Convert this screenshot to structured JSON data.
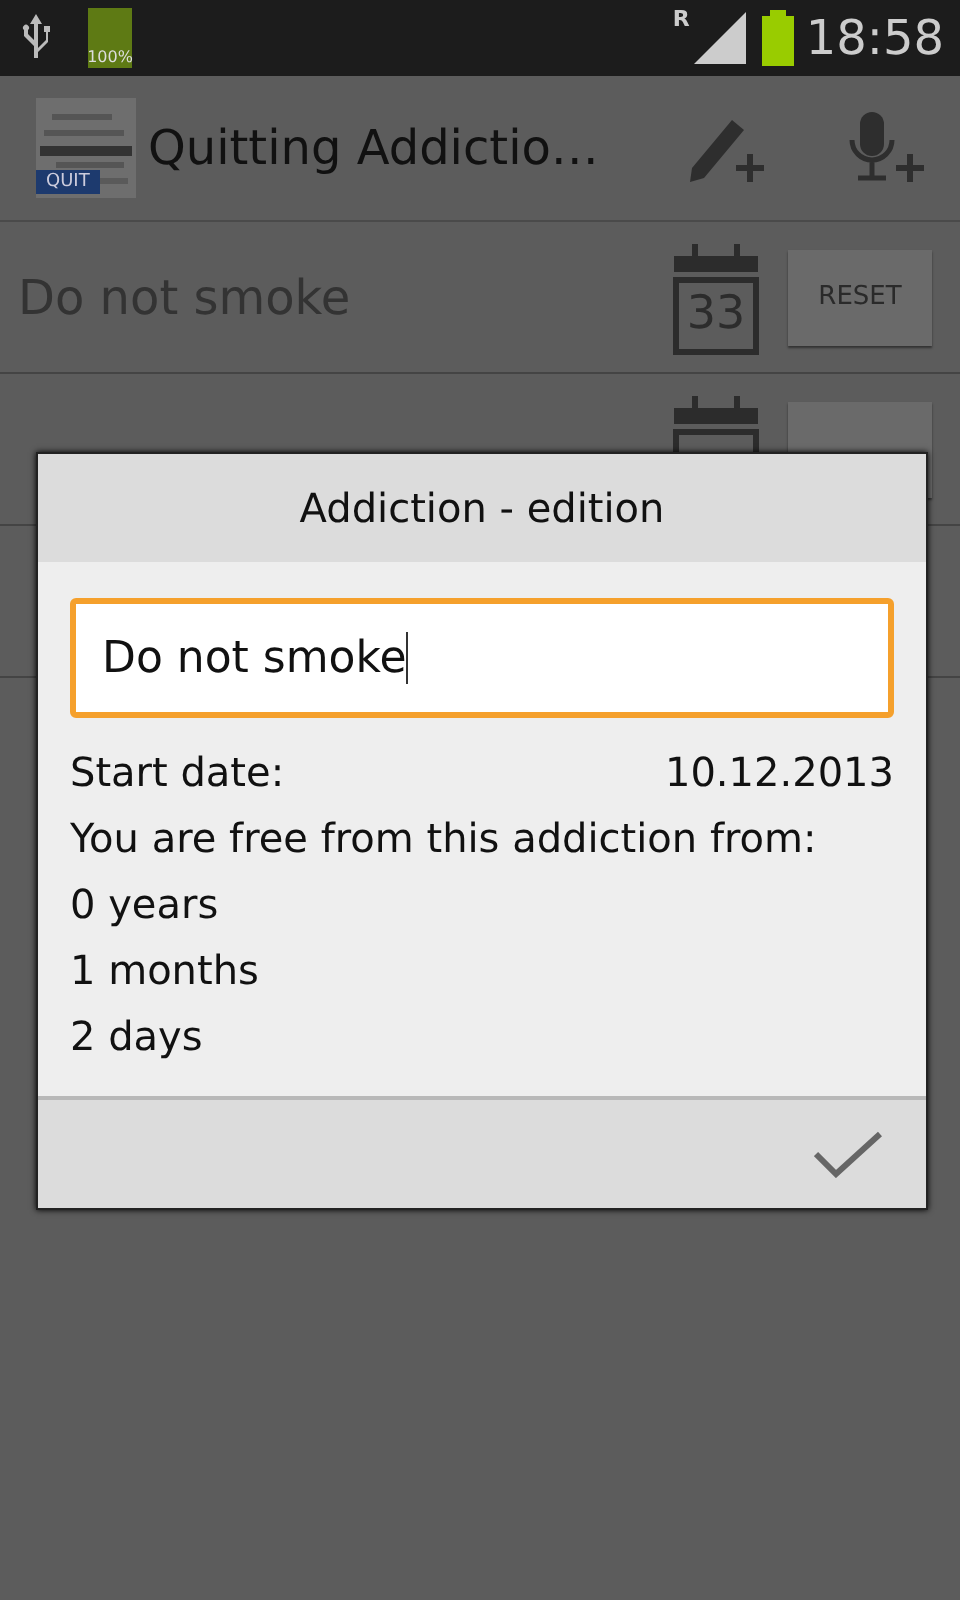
{
  "status_bar": {
    "battery_text": "100%",
    "network_letter": "R",
    "time": "18:58"
  },
  "action_bar": {
    "logo_badge": "QUIT",
    "title": "Quitting Addictio…"
  },
  "addictions": [
    {
      "kind": "full",
      "name": "Do not smoke",
      "calendar_day": "33",
      "button": "RESET"
    },
    {
      "kind": "controls"
    },
    {
      "kind": "plain"
    }
  ],
  "dialog": {
    "title": "Addiction - edition",
    "name_value": "Do not smoke",
    "start_label": "Start date:",
    "start_date": "10.12.2013",
    "free_label": "You are free from this addiction from:",
    "durations": [
      "0 years",
      "1 months",
      "2 days"
    ]
  }
}
